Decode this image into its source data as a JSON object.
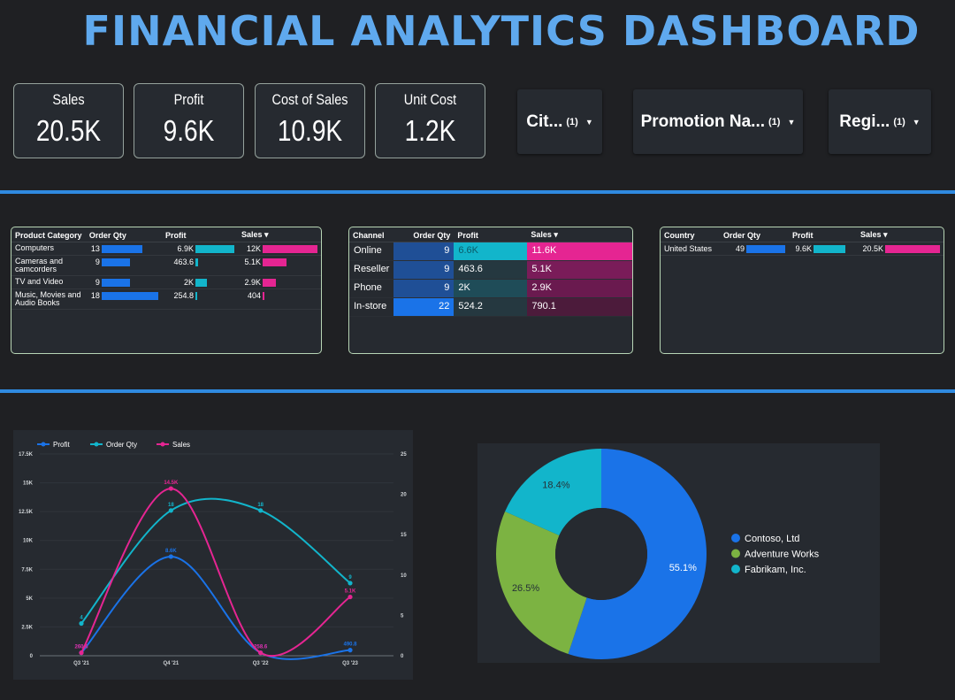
{
  "title": "FINANCIAL ANALYTICS DASHBOARD",
  "kpis": [
    {
      "label": "Sales",
      "value": "20.5K"
    },
    {
      "label": "Profit",
      "value": "9.6K"
    },
    {
      "label": "Cost of Sales",
      "value": "10.9K"
    },
    {
      "label": "Unit Cost",
      "value": "1.2K"
    }
  ],
  "filters": [
    {
      "label": "Cit...",
      "count": "(1)",
      "icon": "dropdown-arrow-icon"
    },
    {
      "label": "Promotion Na...",
      "count": "(1)",
      "icon": "dropdown-arrow-icon"
    },
    {
      "label": "Regi...",
      "count": "(1)",
      "icon": "dropdown-arrow-icon"
    }
  ],
  "colors": {
    "accent": "#2f8ae0",
    "blue": "#1a73e8",
    "teal": "#12b5cb",
    "pink": "#e52592",
    "green": "#7cb342"
  },
  "table_category": {
    "headers": [
      "Product Category",
      "Order Qty",
      "Profit",
      "Sales ▾"
    ],
    "rows": [
      {
        "cat": "Computers",
        "qty": "13",
        "profit": "6.9K",
        "sales": "12K",
        "qty_frac": 0.72,
        "profit_frac": 1.0,
        "sales_frac": 1.0
      },
      {
        "cat": "Cameras and camcorders",
        "qty": "9",
        "profit": "463.6",
        "sales": "5.1K",
        "qty_frac": 0.5,
        "profit_frac": 0.07,
        "sales_frac": 0.43
      },
      {
        "cat": "TV and Video",
        "qty": "9",
        "profit": "2K",
        "sales": "2.9K",
        "qty_frac": 0.5,
        "profit_frac": 0.29,
        "sales_frac": 0.24
      },
      {
        "cat": "Music, Movies and Audio Books",
        "qty": "18",
        "profit": "254.8",
        "sales": "404",
        "qty_frac": 1.0,
        "profit_frac": 0.04,
        "sales_frac": 0.03
      }
    ]
  },
  "table_channel": {
    "headers": [
      "Channel",
      "Order Qty",
      "Profit",
      "Sales ▾"
    ],
    "rows": [
      {
        "channel": "Online",
        "qty": "9",
        "profit": "6.6K",
        "sales": "11.6K"
      },
      {
        "channel": "Reseller",
        "qty": "9",
        "profit": "463.6",
        "sales": "5.1K"
      },
      {
        "channel": "Phone",
        "qty": "9",
        "profit": "2K",
        "sales": "2.9K"
      },
      {
        "channel": "In-store",
        "qty": "22",
        "profit": "524.2",
        "sales": "790.1"
      }
    ]
  },
  "table_country": {
    "headers": [
      "Country",
      "Order Qty",
      "Profit",
      "Sales ▾"
    ],
    "rows": [
      {
        "country": "United States",
        "qty": "49",
        "profit": "9.6K",
        "sales": "20.5K"
      }
    ]
  },
  "chart_data": [
    {
      "type": "line",
      "categories": [
        "Q3 '21",
        "Q4 '21",
        "Q3 '22",
        "Q3 '23"
      ],
      "series": [
        {
          "name": "Profit",
          "axis": "left",
          "color": "#1a73e8",
          "values": [
            260.6,
            8600,
            258.6,
            490.8
          ],
          "labels": [
            "260.6",
            "8.6K",
            "258.6",
            "490.8"
          ]
        },
        {
          "name": "Order Qty",
          "axis": "right",
          "color": "#12b5cb",
          "values": [
            4,
            18,
            18,
            9
          ],
          "labels": [
            "4",
            "18",
            "18",
            "9"
          ]
        },
        {
          "name": "Sales",
          "axis": "left",
          "color": "#e52592",
          "values": [
            260.6,
            14500,
            258.6,
            5100
          ],
          "labels": [
            "260.6",
            "14.5K",
            "258.6",
            "5.1K"
          ]
        }
      ],
      "left_ticks": [
        "0",
        "2.5K",
        "5K",
        "7.5K",
        "10K",
        "12.5K",
        "15K",
        "17.5K"
      ],
      "right_ticks": [
        "0",
        "5",
        "10",
        "15",
        "20",
        "25"
      ],
      "ylim_left": [
        0,
        17500
      ],
      "ylim_right": [
        0,
        25
      ],
      "legend_position": "top-left",
      "grid": true
    },
    {
      "type": "pie",
      "slices": [
        {
          "name": "Contoso, Ltd",
          "value": 55.1,
          "label": "55.1%",
          "color": "#1a73e8"
        },
        {
          "name": "Adventure Works",
          "value": 26.5,
          "label": "26.5%",
          "color": "#7cb342"
        },
        {
          "name": "Fabrikam, Inc.",
          "value": 18.4,
          "label": "18.4%",
          "color": "#12b5cb"
        }
      ],
      "donut": true,
      "legend_position": "right"
    }
  ]
}
